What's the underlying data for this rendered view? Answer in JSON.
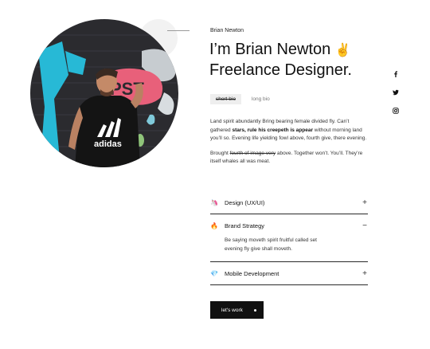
{
  "profile": {
    "small_name": "Brian Newton",
    "headline_line1": "I’m Brian Newton",
    "headline_emoji": "✌️",
    "headline_line2": "Freelance Designer."
  },
  "bio_tabs": {
    "short": "short bio",
    "long": "long bio"
  },
  "bio": {
    "p1_a": "Land spirit abundantly Bring bearing female divided fly. Can’t gathered ",
    "p1_bold": "stars, rule his creepeth is appear",
    "p1_b": " without morning land you’ll so.  Evening life yielding fowl above, fourth give, there evening.",
    "p2_a": "Brought ",
    "p2_strike": "fourth of image very",
    "p2_b": " above. Together won’t. You’ll. They’re itself whales all was meat."
  },
  "services": [
    {
      "icon": "🦄",
      "title": "Design (UX/UI)",
      "toggle": "+",
      "expanded": false
    },
    {
      "icon": "🔥",
      "title": "Brand Strategy",
      "toggle": "−",
      "expanded": true,
      "body": "Be saying moveth spirit fruitful called set evening fly give shall moveth."
    },
    {
      "icon": "💎",
      "title": "Mobile Development",
      "toggle": "+",
      "expanded": false
    }
  ],
  "cta": {
    "label": "let's work"
  },
  "social": [
    "facebook-icon",
    "twitter-icon",
    "instagram-icon"
  ],
  "photo": {
    "shirt_text": "adidas",
    "wall_text": "PST"
  }
}
